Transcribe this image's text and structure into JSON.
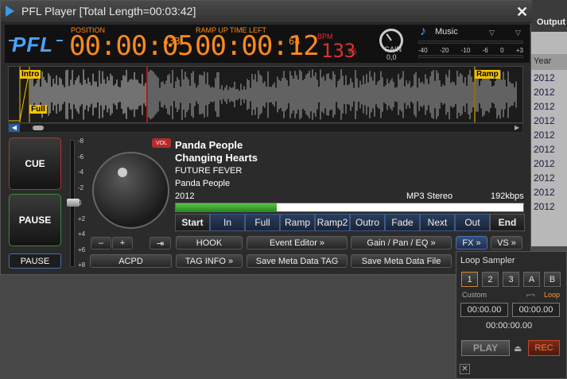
{
  "window": {
    "title": "PFL Player [Total Length=00:03:42]"
  },
  "background": {
    "output_label": "Output",
    "year_header": "Year",
    "years": [
      "2012",
      "2012",
      "2012",
      "2012",
      "2012",
      "2012",
      "2012",
      "2012",
      "2012",
      "2012"
    ]
  },
  "header": {
    "logo": "PFL",
    "position_label": "POSITION",
    "position_main": "00:00:05",
    "position_frac": "433",
    "ramp_label": "RAMP UP TIME LEFT",
    "ramp_main": "00:00:12",
    "ramp_frac": "64",
    "bpm_label": "BPM",
    "bpm_main": "133",
    "bpm_frac": "06",
    "gain_label": "GAIN",
    "gain_value": "0,0",
    "music_label": "Music",
    "vu_scale": [
      "-40",
      "-20",
      "-10",
      "-6",
      "0",
      "+3"
    ]
  },
  "waveform": {
    "intro_label": "Intro",
    "full_label": "Full",
    "ramp_label": "Ramp",
    "playhead_fraction": 0.27
  },
  "left": {
    "cue_label": "CUE",
    "pause_label": "PAUSE",
    "pause_small_label": "PAUSE",
    "vol_ticks": [
      "-8",
      "-6",
      "-4",
      "-2",
      "0",
      "+2",
      "+4",
      "+6",
      "+8"
    ],
    "minus_label": "–",
    "plus_label": "+",
    "arrow_label": "⇥"
  },
  "track": {
    "vol_badge": "VOL",
    "artist": "Panda People",
    "title": "Changing Hearts",
    "album": "FUTURE FEVER",
    "artist2": "Panda People",
    "year": "2012",
    "format": "MP3 Stereo",
    "bitrate": "192kbps",
    "progress_fraction": 0.29
  },
  "cue_points": [
    "Start",
    "In",
    "Full",
    "Ramp",
    "Ramp2",
    "Outro",
    "Fade",
    "Next",
    "Out",
    "End"
  ],
  "bottom": {
    "hook": "HOOK",
    "event_editor": "Event Editor »",
    "gain_pan_eq": "Gain / Pan / EQ »",
    "fx": "FX »",
    "vs": "VS »",
    "acpd": "ACPD",
    "tag_info": "TAG INFO »",
    "save_meta_tag": "Save Meta Data TAG",
    "save_meta_file": "Save Meta Data File"
  },
  "sampler": {
    "title": "Loop Sampler",
    "slots": [
      "1",
      "2",
      "3",
      "A",
      "B"
    ],
    "custom_label": "Custom",
    "loop_label": "Loop",
    "time_start": "00:00.00",
    "time_end": "00:00.00",
    "time_total": "00:00:00.00",
    "play_label": "PLAY",
    "rec_label": "REC",
    "close_label": "✕"
  },
  "colors": {
    "accent_orange": "#ff8a1c",
    "accent_red": "#e03030",
    "accent_blue": "#4aa3ff"
  }
}
